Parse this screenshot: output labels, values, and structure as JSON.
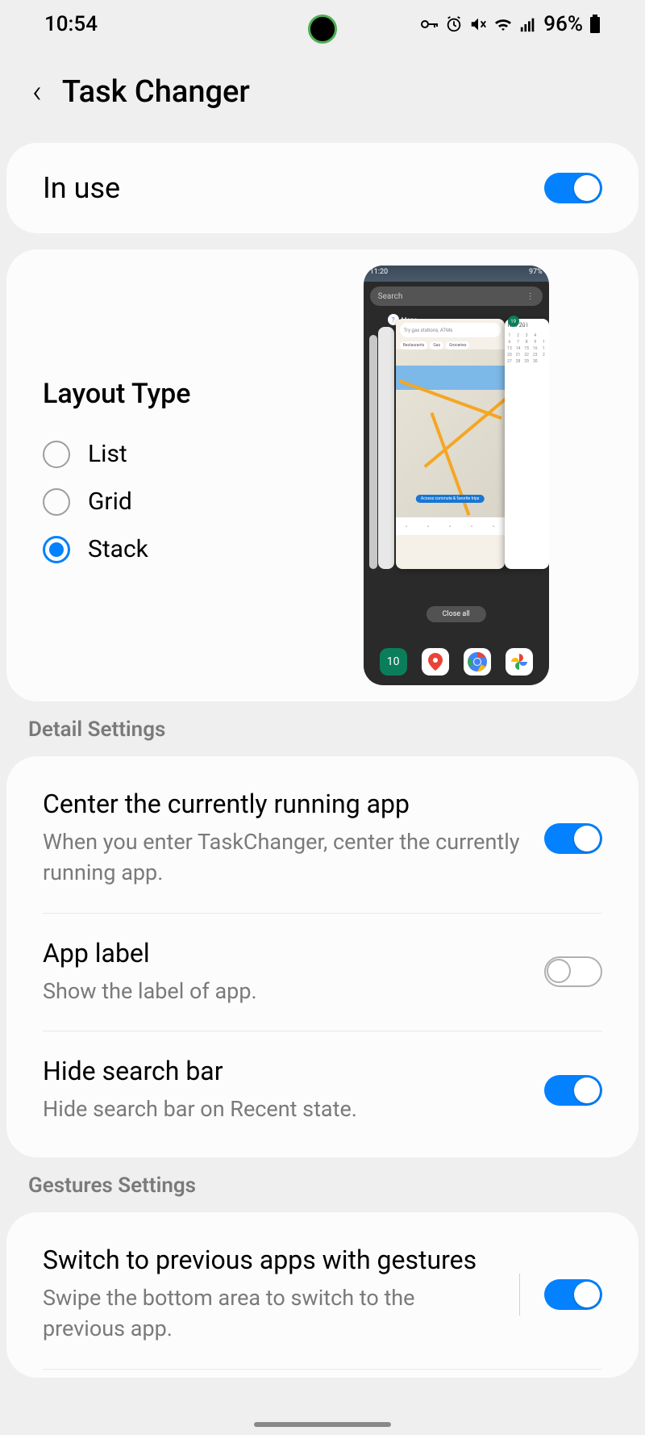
{
  "statusbar": {
    "time": "10:54",
    "battery_pct": "96%",
    "icons": {
      "key": "⚿",
      "alarm": "⏰",
      "mute": "🔇",
      "wifi": "📶",
      "signal": "📶",
      "battery": "🔋"
    }
  },
  "header": {
    "back": "‹",
    "title": "Task Changer"
  },
  "in_use": {
    "label": "In use",
    "enabled": true
  },
  "layout": {
    "title": "Layout Type",
    "options": [
      {
        "value": "list",
        "label": "List",
        "selected": false
      },
      {
        "value": "grid",
        "label": "Grid",
        "selected": false
      },
      {
        "value": "stack",
        "label": "Stack",
        "selected": true
      }
    ]
  },
  "preview": {
    "time": "11:20",
    "battery": "97%",
    "search_placeholder": "Search",
    "app_maps": "Maps",
    "app_calendar": "Calenda",
    "cal_month": "Nov 201",
    "map_search": "Try gas stations, ATMs",
    "chips": [
      "Restaurants",
      "Gas",
      "Groceries"
    ],
    "map_banner": "Access commute & favorite trips",
    "close_all": "Close all",
    "dock": {
      "calendar": "10"
    }
  },
  "sections": {
    "detail": "Detail Settings",
    "gestures": "Gestures Settings"
  },
  "settings": {
    "center_app": {
      "title": "Center the currently running app",
      "desc": "When you enter TaskChanger, center the currently running app.",
      "enabled": true
    },
    "app_label": {
      "title": "App label",
      "desc": "Show the label of app.",
      "enabled": false
    },
    "hide_search": {
      "title": "Hide search bar",
      "desc": "Hide search bar on Recent state.",
      "enabled": true
    },
    "gesture_switch": {
      "title": "Switch to previous apps with gestures",
      "desc": "Swipe the bottom area to switch to the previous app.",
      "enabled": true
    }
  }
}
